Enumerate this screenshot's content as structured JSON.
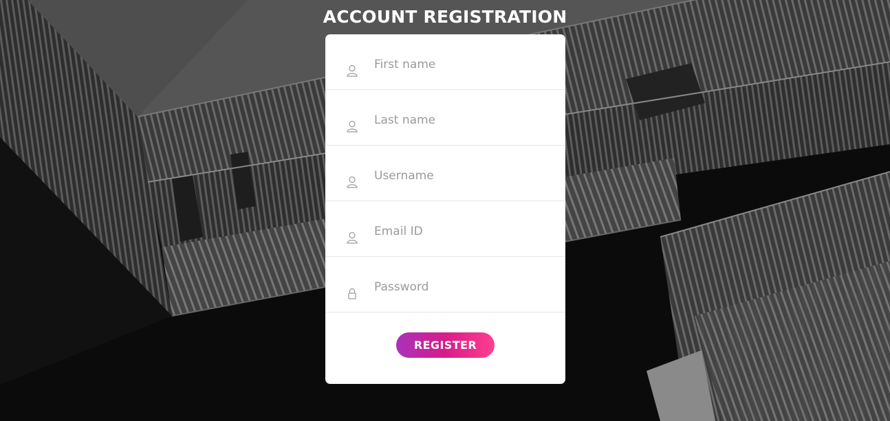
{
  "page": {
    "title": "ACCOUNT REGISTRATION"
  },
  "form": {
    "fields": [
      {
        "placeholder": "First name",
        "icon": "user-icon"
      },
      {
        "placeholder": "Last name",
        "icon": "user-icon"
      },
      {
        "placeholder": "Username",
        "icon": "user-icon"
      },
      {
        "placeholder": "Email ID",
        "icon": "user-icon"
      },
      {
        "placeholder": "Password",
        "icon": "lock-icon"
      }
    ],
    "submit_label": "REGISTER"
  },
  "colors": {
    "button_gradient_start": "#a833b9",
    "button_gradient_end": "#ff3f8e",
    "card": "#ffffff",
    "placeholder": "#9a9a9a"
  }
}
